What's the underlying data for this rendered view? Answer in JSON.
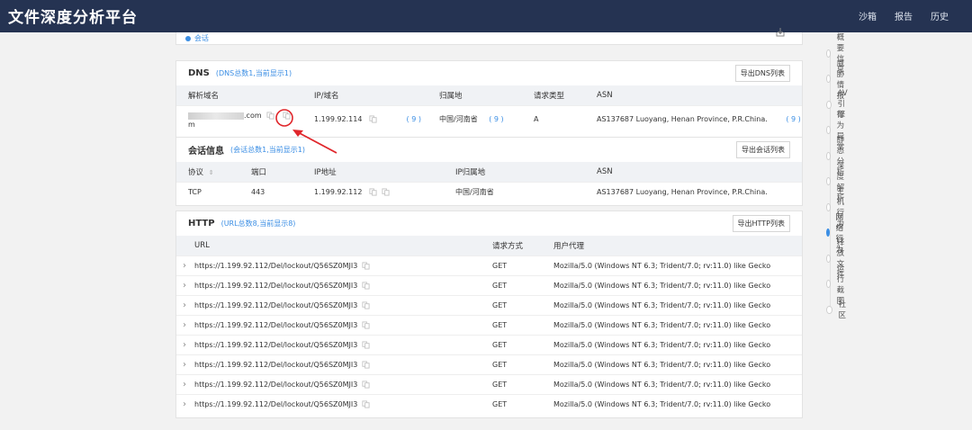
{
  "app": {
    "title": "文件深度分析平台",
    "nav": [
      "沙箱",
      "报告",
      "历史"
    ]
  },
  "session_top": {
    "label": "会话"
  },
  "dns": {
    "title": "DNS",
    "subtitle": "(DNS总数1,当前显示1)",
    "export_label": "导出DNS列表",
    "columns": [
      "解析域名",
      "IP/域名",
      "归属地",
      "请求类型",
      "ASN"
    ],
    "rows": [
      {
        "domain_line1": ".com",
        "domain_line2": "m",
        "ip": "1.199.92.114",
        "ip_count": "( 9 )",
        "location": "中国/河南省",
        "location_count": "( 9 )",
        "type": "A",
        "asn": "AS137687 Luoyang, Henan Province, P.R.China.",
        "asn_count": "( 9 )"
      }
    ]
  },
  "session": {
    "title": "会话信息",
    "subtitle": "(会话总数1,当前显示1)",
    "export_label": "导出会话列表",
    "columns": [
      "协议",
      "端口",
      "IP地址",
      "IP归属地",
      "ASN"
    ],
    "sort_icon": "sort-icon",
    "rows": [
      {
        "protocol": "TCP",
        "port": "443",
        "ip": "1.199.92.112",
        "location": "中国/河南省",
        "asn": "AS137687 Luoyang, Henan Province, P.R.China."
      }
    ]
  },
  "http": {
    "title": "HTTP",
    "subtitle": "(URL总数8,当前显示8)",
    "export_label": "导出HTTP列表",
    "columns": [
      "URL",
      "请求方式",
      "用户代理"
    ],
    "rows": [
      {
        "url": "https://1.199.92.112/Del/lockout/Q56SZ0MJI3",
        "method": "GET",
        "agent": "Mozilla/5.0 (Windows NT 6.3; Trident/7.0; rv:11.0) like Gecko"
      },
      {
        "url": "https://1.199.92.112/Del/lockout/Q56SZ0MJI3",
        "method": "GET",
        "agent": "Mozilla/5.0 (Windows NT 6.3; Trident/7.0; rv:11.0) like Gecko"
      },
      {
        "url": "https://1.199.92.112/Del/lockout/Q56SZ0MJI3",
        "method": "GET",
        "agent": "Mozilla/5.0 (Windows NT 6.3; Trident/7.0; rv:11.0) like Gecko"
      },
      {
        "url": "https://1.199.92.112/Del/lockout/Q56SZ0MJI3",
        "method": "GET",
        "agent": "Mozilla/5.0 (Windows NT 6.3; Trident/7.0; rv:11.0) like Gecko"
      },
      {
        "url": "https://1.199.92.112/Del/lockout/Q56SZ0MJI3",
        "method": "GET",
        "agent": "Mozilla/5.0 (Windows NT 6.3; Trident/7.0; rv:11.0) like Gecko"
      },
      {
        "url": "https://1.199.92.112/Del/lockout/Q56SZ0MJI3",
        "method": "GET",
        "agent": "Mozilla/5.0 (Windows NT 6.3; Trident/7.0; rv:11.0) like Gecko"
      },
      {
        "url": "https://1.199.92.112/Del/lockout/Q56SZ0MJI3",
        "method": "GET",
        "agent": "Mozilla/5.0 (Windows NT 6.3; Trident/7.0; rv:11.0) like Gecko"
      },
      {
        "url": "https://1.199.92.112/Del/lockout/Q56SZ0MJI3",
        "method": "GET",
        "agent": "Mozilla/5.0 (Windows NT 6.3; Trident/7.0; rv:11.0) like Gecko"
      }
    ]
  },
  "sidenav": {
    "items": [
      "概要信息",
      "威胁情报",
      "AV引擎",
      "行为异常",
      "静态分析",
      "深度解析",
      "主机行为",
      "网络行为",
      "释放文件",
      "运行截图",
      "社区"
    ],
    "active": "网络行为"
  },
  "colors": {
    "topbar": "#253352",
    "accent": "#3b8ee4",
    "annotation": "#e0262b"
  },
  "icons": {
    "copy": "copy-icon",
    "expand": "chevron-right-icon",
    "download": "download-icon"
  }
}
